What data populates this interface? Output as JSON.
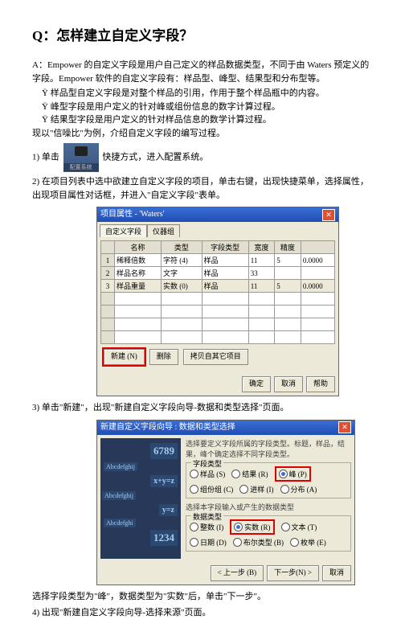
{
  "title": "Q：怎样建立自定义字段？",
  "intro1": "A：Empower 的自定义字段是用户自己定义的样品数据类型，不同于由 Waters 预定义的字段。Empower 软件的自定义字段有：样品型、峰型、结果型和分布型等。",
  "bullet1": "Ÿ   样品型自定义字段是对整个样品的引用，作用于整个样品瓶中的内容。",
  "bullet2": "Ÿ   峰型字段是用户定义的针对峰或组份信息的数字计算过程。",
  "bullet3": "Ÿ   结果型字段是用户定义的针对样品信息的数学计算过程。",
  "intro2": "现以\"信噪比\"为例，介绍自定义字段的编写过程。",
  "step1_pre": "1) 单击",
  "step1_post": "快捷方式，进入配置系统。",
  "shortcut_label": "配置系统",
  "step2": "2) 在项目列表中选中欲建立自定义字段的项目，单击右键，出现快捷菜单，选择属性，出现项目属性对话框，并进入\"自定义字段\"表单。",
  "dlg1": {
    "title": "项目属性 - 'Waters'",
    "tab1": "自定义字段",
    "tab2": "仪器组",
    "cols": [
      "名称",
      "类型",
      "字段类型",
      "宽度",
      "精度"
    ],
    "rows": [
      [
        "1",
        "稀释倍数",
        "字符 (4)",
        "样品",
        "11",
        "5",
        "0.0000"
      ],
      [
        "2",
        "样品名称",
        "文字",
        "样品",
        "33",
        "",
        ""
      ],
      [
        "3",
        "样品重量",
        "实数 (0)",
        "样品",
        "11",
        "5",
        "0.0000"
      ]
    ],
    "btn_new": "新建 (N)",
    "btn_del": "删除",
    "btn_copy": "拷贝自其它项目",
    "btn_ok": "确定",
    "btn_cancel": "取消",
    "btn_help": "帮助"
  },
  "step3": "3) 单击\"新建\"，出现\"新建自定义字段向导-数据和类型选择\"页面。",
  "dlg2": {
    "title": "新建自定义字段向导 : 数据和类型选择",
    "desc": "选择要定义字段所属的字段类型。标题，样品，结果，峰个确定选择不同字段类型。",
    "grp1": "字段类型",
    "r_sample": "样品 (S)",
    "r_result": "结果 (R)",
    "r_peak": "峰 (P)",
    "r_comp": "组份组 (C)",
    "r_inj": "进样 (I)",
    "r_dist": "分布 (A)",
    "desc2": "选择本字段输入或产生的数据类型",
    "grp2": "数据类型",
    "r_int": "整数 (I)",
    "r_real": "实数 (R)",
    "r_text": "文本 (T)",
    "r_date": "日期 (D)",
    "r_bool": "布尔类型 (B)",
    "r_enum": "枚举 (E)",
    "btn_back": "< 上一步 (B)",
    "btn_next": "下一步(N) >",
    "btn_cancel": "取消"
  },
  "step4_pre": "选择字段类型为\"峰\"，数据类型为\"实数\"后，单击\"下一步\"。",
  "step4": "4)  出现\"新建自定义字段向导-选择来源\"页面。"
}
